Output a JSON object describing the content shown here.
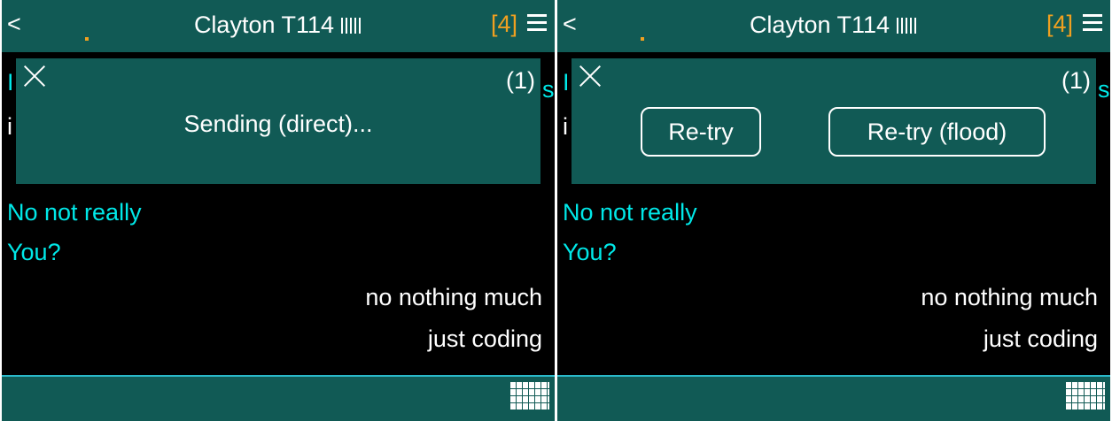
{
  "left": {
    "header": {
      "back_label": "<",
      "title": "Clayton T114",
      "badge": "[4]"
    },
    "peek": {
      "top_left": "I",
      "second_left": "i",
      "top_right": "s"
    },
    "messages": [
      {
        "text": "No not really",
        "direction": "in"
      },
      {
        "text": "You?",
        "direction": "in"
      },
      {
        "text": "no nothing much",
        "direction": "out"
      },
      {
        "text": "just coding",
        "direction": "out"
      }
    ],
    "dialog": {
      "count": "(1)",
      "status": "Sending (direct)..."
    }
  },
  "right": {
    "header": {
      "back_label": "<",
      "title": "Clayton T114",
      "badge": "[4]"
    },
    "peek": {
      "top_left": "I",
      "second_left": "i",
      "top_right": "s"
    },
    "messages": [
      {
        "text": "No not really",
        "direction": "in"
      },
      {
        "text": "You?",
        "direction": "in"
      },
      {
        "text": "no nothing much",
        "direction": "out"
      },
      {
        "text": "just coding",
        "direction": "out"
      }
    ],
    "dialog": {
      "count": "(1)",
      "retry_label": "Re-try",
      "retry_flood_label": "Re-try (flood)"
    }
  },
  "colors": {
    "bar": "#115a55",
    "incoming_text": "#00e8e8",
    "outgoing_text": "#ffffff",
    "badge": "#f0a020",
    "background": "#000000"
  },
  "icons": [
    "back-icon",
    "signal-icon",
    "menu-icon",
    "close-icon",
    "keyboard-icon"
  ]
}
